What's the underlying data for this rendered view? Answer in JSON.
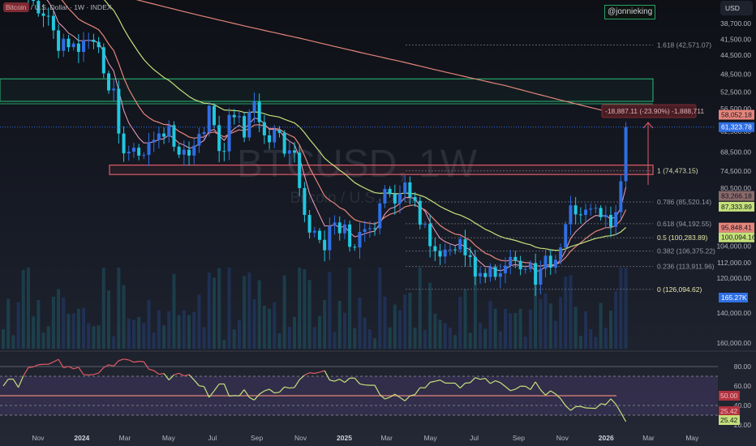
{
  "header": {
    "symbol_short": "Bitcoin",
    "title_rest": " / U.S. Dollar · 1W · INDEX",
    "currency": "USD",
    "handle": "@jonnieking"
  },
  "watermark": {
    "main": "BTCUSD, 1W",
    "sub": "Bitcoin / U.S. Dollar"
  },
  "measure": {
    "label": "-18,887.11 (-23.90%) -1,888,711"
  },
  "price_axis": [
    "38,700.00",
    "41,500.00",
    "44,500.00",
    "48,500.00",
    "52,500.00",
    "56,500.00",
    "62,500.00",
    "68,500.00",
    "74,500.00",
    "80,500.00",
    "104,000.00",
    "112,000.00",
    "120,000.00",
    "140,000.00",
    "160,000.00"
  ],
  "price_badges": [
    {
      "text": "58,052.18",
      "value": 58052.18,
      "color": "#e5857a"
    },
    {
      "text": "61,323.78",
      "value": 61323.78,
      "color": "#2f6fe4"
    },
    {
      "text": "83,266.18",
      "value": 83266.18,
      "color": "#8a6a6a"
    },
    {
      "text": "87,333.89",
      "value": 87333.89,
      "color": "#c5e17a"
    },
    {
      "text": "95,848.41",
      "value": 95848.41,
      "color": "#e5857a"
    },
    {
      "text": "100,094.16",
      "value": 100094.16,
      "color": "#c5e17a"
    }
  ],
  "volume_badge": {
    "text": "165.27K",
    "color": "#2f6fe4"
  },
  "fib_levels": [
    {
      "label": "1.618 (42,571.07)",
      "price": 42571.07,
      "color": "#9598a1"
    },
    {
      "label": "1 (74,473.15)",
      "price": 74473.15,
      "color": "#d8dcb0"
    },
    {
      "label": "0.786 (85,520.14)",
      "price": 85520.14,
      "color": "#9598a1"
    },
    {
      "label": "0.618 (94,192.55)",
      "price": 94192.55,
      "color": "#9598a1"
    },
    {
      "label": "0.5 (100,283.89)",
      "price": 100283.89,
      "color": "#e6e6a8"
    },
    {
      "label": "0.382 (106,375.22)",
      "price": 106375.22,
      "color": "#9598a1"
    },
    {
      "label": "0.236 (113,911.96)",
      "price": 113911.96,
      "color": "#9598a1"
    },
    {
      "label": "0 (126,094.62)",
      "price": 126094.62,
      "color": "#e6e6a8"
    }
  ],
  "time_axis": [
    {
      "label": "Nov",
      "date": "2023-11-01"
    },
    {
      "label": "2024",
      "date": "2024-01-01",
      "year": true
    },
    {
      "label": "Mar",
      "date": "2024-03-01"
    },
    {
      "label": "May",
      "date": "2024-05-01"
    },
    {
      "label": "Jul",
      "date": "2024-07-01"
    },
    {
      "label": "Sep",
      "date": "2024-09-01"
    },
    {
      "label": "Nov",
      "date": "2024-11-01"
    },
    {
      "label": "2025",
      "date": "2025-01-01",
      "year": true
    },
    {
      "label": "Mar",
      "date": "2025-03-01"
    },
    {
      "label": "May",
      "date": "2025-05-01"
    },
    {
      "label": "Jul",
      "date": "2025-07-01"
    },
    {
      "label": "Sep",
      "date": "2025-09-01"
    },
    {
      "label": "Nov",
      "date": "2025-11-01"
    },
    {
      "label": "2026",
      "date": "2026-01-01",
      "year": true
    },
    {
      "label": "Mar",
      "date": "2026-03-01"
    },
    {
      "label": "May",
      "date": "2026-05-01"
    }
  ],
  "rsi_axis": [
    "80.00",
    "60.00",
    "40.00",
    "20.00"
  ],
  "rsi_badges": [
    {
      "text": "50.00",
      "color": "#b2333f"
    },
    {
      "text": "25.42",
      "color": "#b2333f"
    },
    {
      "text": "25.42",
      "color": "#c5e17a"
    }
  ],
  "colors": {
    "up": "#22c7e0",
    "down": "#2f6fe4",
    "ma_fast": "#f2a0c0",
    "ma_mid": "#e5857a",
    "ma_slow": "#c5e17a",
    "ma_long": "#e5857a",
    "zone_green": "#26a269",
    "zone_red": "#e05a66"
  },
  "chart_data": {
    "type": "candlestick",
    "title": "BTCUSD, 1W",
    "yscale": "log, inverted",
    "ylim": [
      38700,
      160000
    ],
    "start_week": "2023-09-18",
    "closes": [
      26.5,
      27.9,
      27.9,
      26.9,
      29.9,
      34.5,
      35.0,
      37.0,
      37.4,
      37.4,
      39.9,
      43.7,
      41.4,
      43.0,
      42.3,
      43.9,
      41.7,
      41.6,
      42.0,
      43.0,
      48.3,
      52.1,
      51.7,
      63.1,
      68.9,
      68.4,
      67.2,
      69.6,
      69.4,
      65.6,
      64.9,
      63.1,
      64.0,
      60.8,
      66.9,
      69.3,
      67.8,
      69.6,
      66.6,
      63.2,
      62.7,
      55.8,
      60.8,
      68.2,
      68.3,
      58.1,
      58.7,
      58.4,
      64.2,
      57.3,
      54.8,
      60.0,
      63.6,
      65.6,
      62.1,
      62.9,
      69.0,
      68.0,
      68.7,
      80.4,
      90.6,
      98.0,
      97.2,
      101.2,
      106.0,
      95.1,
      93.7,
      98.3,
      94.5,
      104.4,
      104.7,
      97.7,
      96.5,
      96.1,
      96.2,
      86.1,
      80.7,
      82.6,
      86.1,
      82.4,
      78.4,
      83.7,
      85.1,
      94.6,
      94.3,
      104.1,
      106.4,
      109.0,
      105.7,
      105.6,
      105.6,
      100.9,
      108.4,
      109.2,
      119.1,
      117.3,
      119.4,
      114.2,
      119.3,
      117.4,
      113.5,
      109.2,
      111.1,
      115.3,
      115.2,
      112.2,
      123.5,
      115.1,
      108.6,
      114.5,
      110.6,
      104.7,
      94.4,
      86.8,
      90.4,
      90.6,
      88.5,
      88.1,
      87.8,
      91.5,
      90.6,
      95.5,
      89.5,
      78.0,
      61.3
    ],
    "close_units": "thousand USD",
    "ma_long_anchors": [
      [
        0,
        30.5
      ],
      [
        20,
        33.5
      ],
      [
        40,
        37.5
      ],
      [
        60,
        41.5
      ],
      [
        80,
        46.0
      ],
      [
        100,
        51.0
      ],
      [
        123,
        58.05
      ]
    ],
    "zones": [
      {
        "name": "green-zone",
        "from": 49500,
        "to": 54700
      },
      {
        "name": "red-zone",
        "from": 72600,
        "to": 75700
      }
    ],
    "rsi_levels": [
      80,
      70,
      50,
      40,
      30
    ]
  }
}
